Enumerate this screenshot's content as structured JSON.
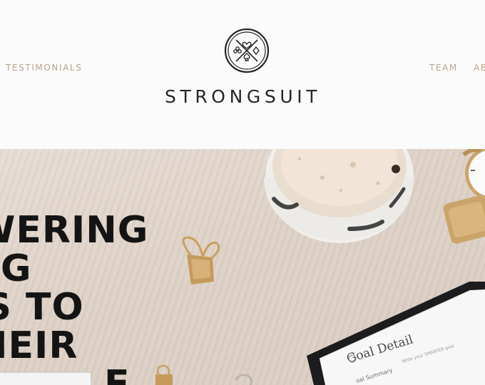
{
  "nav": {
    "left": [
      {
        "label": "TESTIMONIALS"
      }
    ],
    "right": [
      {
        "label": "TEAM"
      },
      {
        "label": "AB"
      }
    ]
  },
  "brand": {
    "name": "STRONGSUIT"
  },
  "hero": {
    "headline_lines": [
      "WERING",
      "ING",
      "TS TO",
      "HEIR",
      "E"
    ],
    "tablet": {
      "title": "Goal Detail",
      "hint": "Write your SMARTER goal",
      "row_label": "oal Summary"
    }
  },
  "colors": {
    "nav": "#b9a58c",
    "brand": "#262626",
    "headline": "#141414"
  },
  "icons": {
    "logo": "card-suits-emblem-icon"
  }
}
